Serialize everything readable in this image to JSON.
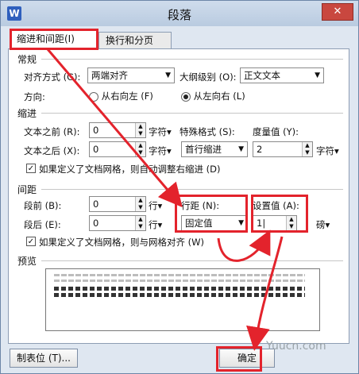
{
  "window": {
    "title": "段落",
    "app_icon": "W",
    "close_label": "✕"
  },
  "tabs": [
    {
      "label": "缩进和间距(I)"
    },
    {
      "label": "换行和分页(P)"
    }
  ],
  "general": {
    "section": "常规",
    "alignment_label": "对齐方式 (G):",
    "alignment_value": "两端对齐",
    "outline_label": "大纲级别 (O):",
    "outline_value": "正文文本",
    "direction_label": "方向:",
    "rtl_label": "从右向左 (F)",
    "ltr_label": "从左向右 (L)"
  },
  "indent": {
    "section": "缩进",
    "before_label": "文本之前 (R):",
    "before_value": "0",
    "before_unit": "字符▾",
    "after_label": "文本之后 (X):",
    "after_value": "0",
    "after_unit": "字符▾",
    "special_label": "特殊格式 (S):",
    "special_value": "首行缩进",
    "measure_label": "度量值 (Y):",
    "measure_value": "2",
    "measure_unit": "字符▾",
    "auto_adjust_label": "如果定义了文档网格，则自动调整右缩进 (D)"
  },
  "spacing": {
    "section": "间距",
    "before_label": "段前 (B):",
    "before_value": "0",
    "before_unit": "行▾",
    "after_label": "段后 (E):",
    "after_value": "0",
    "after_unit": "行▾",
    "line_label": "行距 (N):",
    "line_value": "固定值",
    "set_label": "设置值 (A):",
    "set_value": "1|",
    "set_unit": "磅▾",
    "grid_label": "如果定义了文档网格，则与网格对齐 (W)"
  },
  "preview": {
    "section": "预览"
  },
  "buttons": {
    "tabs_label": "制表位 (T)...",
    "ok_label": "确定"
  },
  "watermark": "Yuucn.com",
  "colors": {
    "highlight": "#e3232c"
  }
}
